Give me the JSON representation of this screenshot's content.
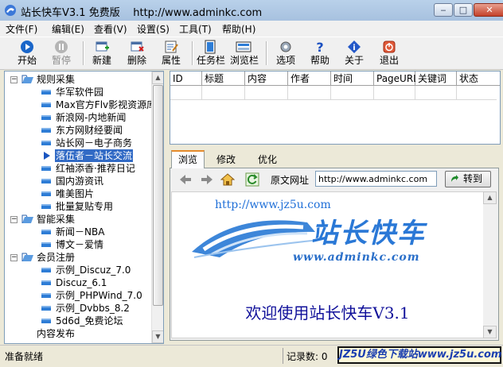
{
  "window": {
    "title": "站长快车V3.1 免费版",
    "url": "http://www.adminkc.com"
  },
  "window_buttons": {
    "minimize": "‒",
    "maximize": "□",
    "close": "✕"
  },
  "menu": [
    "文件(F)",
    "编辑(E)",
    "查看(V)",
    "设置(S)",
    "工具(T)",
    "帮助(H)"
  ],
  "toolbar": [
    {
      "label": "开始",
      "icon": "play-icon",
      "enabled": true
    },
    {
      "label": "暂停",
      "icon": "pause-icon",
      "enabled": false
    },
    {
      "label": "新建",
      "icon": "new-icon",
      "enabled": true
    },
    {
      "label": "删除",
      "icon": "delete-icon",
      "enabled": true
    },
    {
      "label": "属性",
      "icon": "properties-icon",
      "enabled": true
    },
    {
      "label": "任务栏",
      "icon": "taskbar-icon",
      "enabled": true
    },
    {
      "label": "浏览栏",
      "icon": "browser-bar-icon",
      "enabled": true
    },
    {
      "label": "选项",
      "icon": "options-icon",
      "enabled": true
    },
    {
      "label": "帮助",
      "icon": "help-icon",
      "enabled": true
    },
    {
      "label": "关于",
      "icon": "about-icon",
      "enabled": true
    },
    {
      "label": "退出",
      "icon": "exit-icon",
      "enabled": true
    }
  ],
  "tree": {
    "groups": [
      {
        "label": "规则采集",
        "expanded": true,
        "items": [
          "华军软件园",
          "Max官方Flv影视资源库",
          "新浪网-内地新闻",
          "东方网财经要闻",
          "站长网－电子商务",
          "落伍者－站长交流",
          "红袖添香·推荐日记",
          "国内游资讯",
          "唯美图片",
          "批量复贴专用"
        ]
      },
      {
        "label": "智能采集",
        "expanded": true,
        "items": [
          "新闻－NBA",
          "博文－爱情"
        ]
      },
      {
        "label": "会员注册",
        "expanded": true,
        "items": [
          "示例_Discuz_7.0",
          "Discuz_6.1",
          "示例_PHPWind_7.0",
          "示例_Dvbbs_8.2",
          "5d6d_免费论坛"
        ]
      }
    ],
    "selected": "落伍者－站长交流",
    "partial_last": "内容发布"
  },
  "grid": {
    "columns": [
      "ID",
      "标题",
      "内容",
      "作者",
      "时间",
      "PageURL",
      "关键词",
      "状态"
    ]
  },
  "tabs": [
    "浏览",
    "修改",
    "优化"
  ],
  "browser": {
    "address_label": "原文网址",
    "address_value": "http://www.adminkc.com",
    "go_label": "转到",
    "logo_url_top": "http://www.jz5u.com",
    "logo_cn": "站长快车",
    "logo_url_bottom": "www.adminkc.com",
    "welcome": "欢迎使用站长快车V3.1"
  },
  "status": {
    "text": "准备就绪",
    "record_label": "记录数: 0",
    "watermark": "JZ5U绿色下载站www.jz5u.com"
  },
  "colors": {
    "accent": "#316ac5",
    "welcome": "#10109a",
    "logo": "#2a78d6"
  }
}
